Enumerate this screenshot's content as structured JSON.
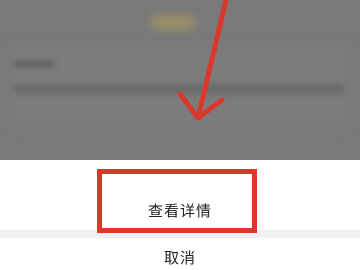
{
  "action_sheet": {
    "view_details_label": "查看详情",
    "cancel_label": "取消"
  },
  "annotation": {
    "highlight_color": "#d9382b",
    "arrow_color": "#d9382b"
  }
}
